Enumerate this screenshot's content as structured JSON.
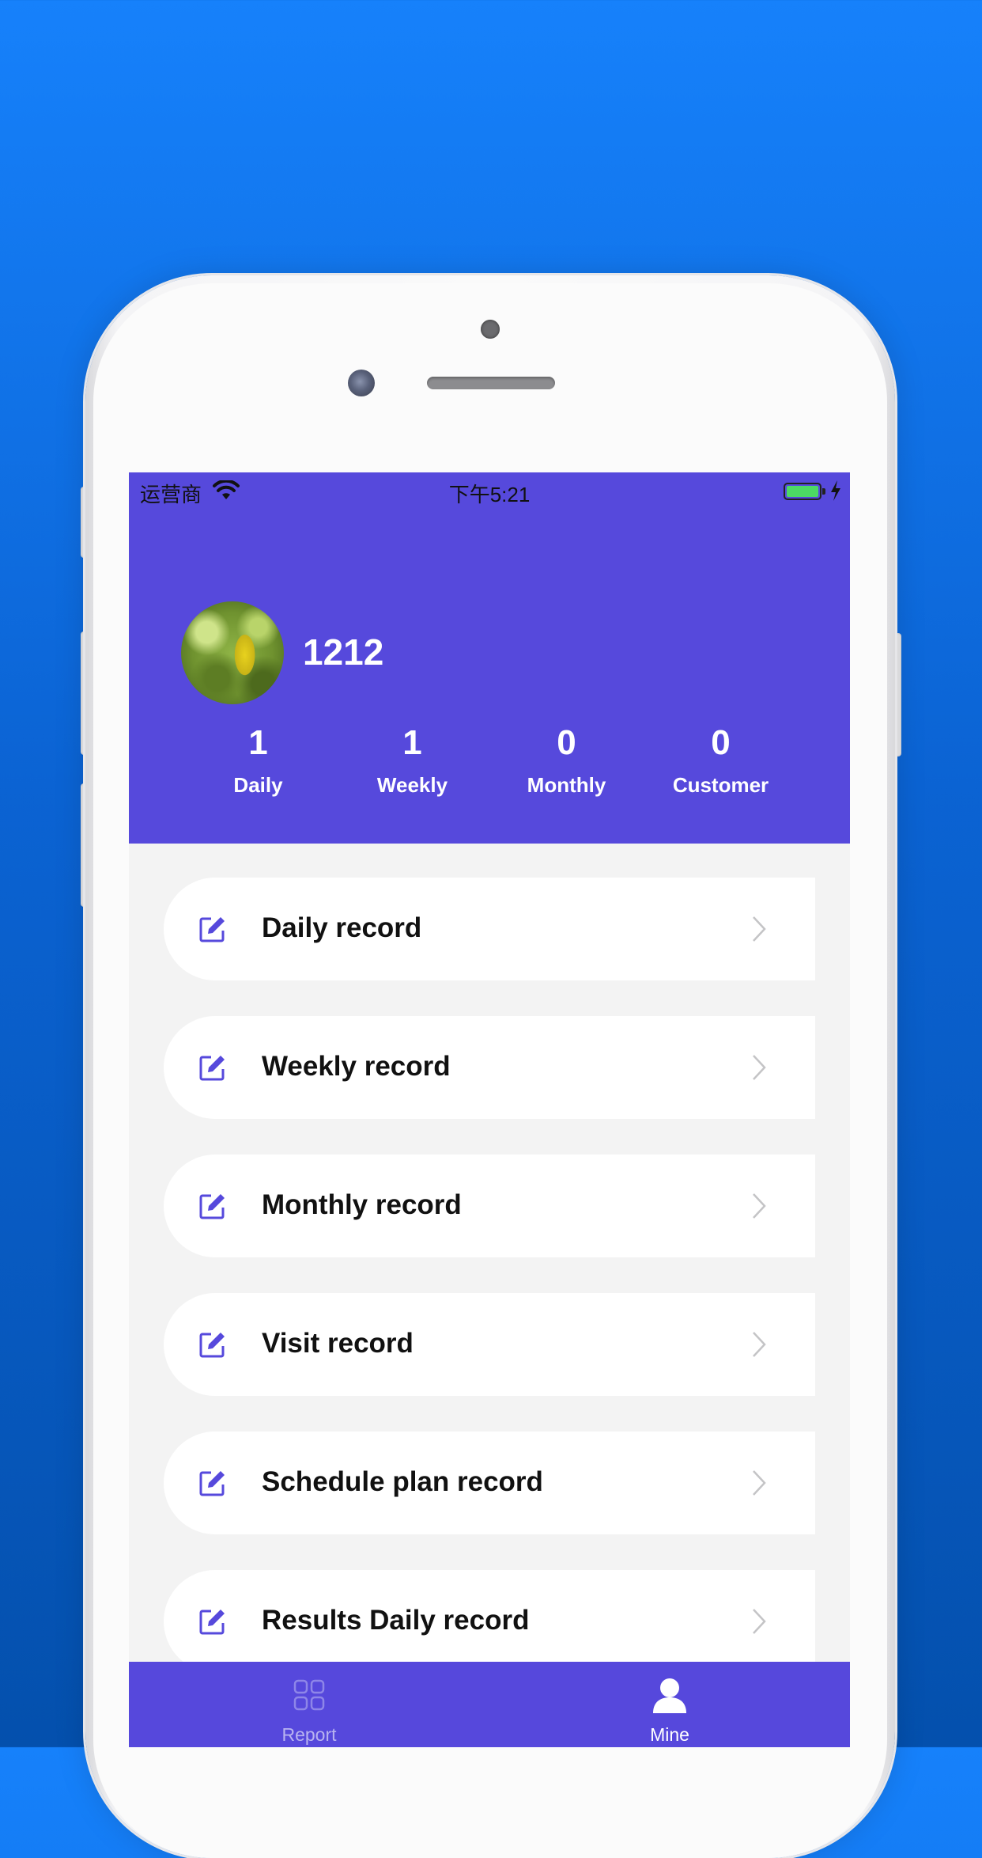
{
  "status_bar": {
    "carrier": "运营商",
    "time": "下午5:21",
    "wifi_icon": "wifi-icon",
    "battery_icon": "battery-icon"
  },
  "profile": {
    "username": "1212",
    "stats": [
      {
        "value": "1",
        "label": "Daily"
      },
      {
        "value": "1",
        "label": "Weekly"
      },
      {
        "value": "0",
        "label": "Monthly"
      },
      {
        "value": "0",
        "label": "Customer"
      }
    ]
  },
  "menu": {
    "items": [
      {
        "label": "Daily record",
        "icon": "edit-icon"
      },
      {
        "label": "Weekly record",
        "icon": "edit-icon"
      },
      {
        "label": "Monthly record",
        "icon": "edit-icon"
      },
      {
        "label": "Visit record",
        "icon": "edit-icon"
      },
      {
        "label": "Schedule plan record",
        "icon": "edit-icon"
      },
      {
        "label": "Results Daily record",
        "icon": "edit-icon"
      }
    ]
  },
  "tabbar": {
    "tabs": [
      {
        "label": "Report",
        "icon": "grid-icon",
        "active": false
      },
      {
        "label": "Mine",
        "icon": "person-icon",
        "active": true
      }
    ]
  },
  "colors": {
    "background": "#0b63d3",
    "header": "#5649dc",
    "accent": "#5648dc",
    "battery": "#4cd964"
  }
}
